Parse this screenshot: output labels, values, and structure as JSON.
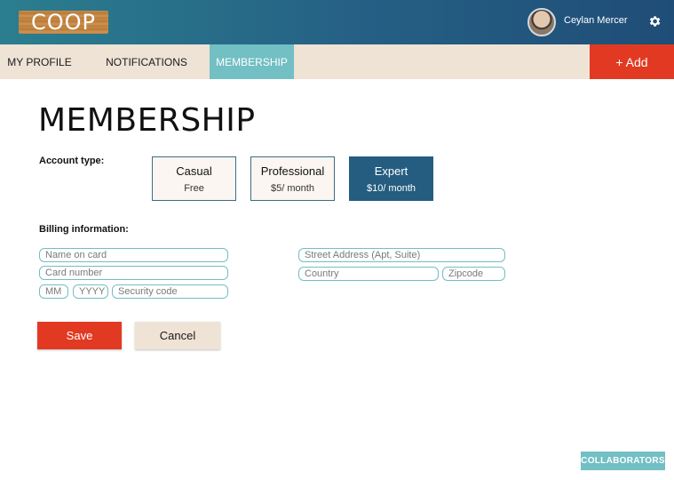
{
  "header": {
    "logo_text": "COOP",
    "user_name": "Ceylan Mercer",
    "settings_icon": "gear-icon",
    "avatar_icon": "user-avatar"
  },
  "nav": {
    "tabs": [
      {
        "label": "MY PROFILE"
      },
      {
        "label": "NOTIFICATIONS"
      },
      {
        "label": "MEMBERSHIP",
        "active": true
      }
    ],
    "add_label": "+ Add"
  },
  "main": {
    "title": "MEMBERSHIP",
    "account_type_label": "Account type:",
    "plans": [
      {
        "name": "Casual",
        "price": "Free"
      },
      {
        "name": "Professional",
        "price": "$5/ month"
      },
      {
        "name": "Expert",
        "price": "$10/ month",
        "selected": true
      }
    ],
    "billing_label": "Billing information:",
    "fields": {
      "name_on_card": {
        "placeholder": "Name on card",
        "value": ""
      },
      "card_number": {
        "placeholder": "Card number",
        "value": ""
      },
      "mm": {
        "placeholder": "MM",
        "value": ""
      },
      "yyyy": {
        "placeholder": "YYYY",
        "value": ""
      },
      "security_code": {
        "placeholder": "Security code",
        "value": ""
      },
      "street_address": {
        "placeholder": "Street Address (Apt, Suite)",
        "value": ""
      },
      "country": {
        "placeholder": "Country",
        "value": ""
      },
      "zipcode": {
        "placeholder": "Zipcode",
        "value": ""
      }
    },
    "save_label": "Save",
    "cancel_label": "Cancel"
  },
  "footer": {
    "collaborators_label": "COLLABORATORS"
  },
  "colors": {
    "header_gradient_start": "#2b7e8f",
    "header_gradient_end": "#1f4d77",
    "nav_background": "#efe3d6",
    "active_tab": "#72bfc4",
    "accent_red": "#e23a22",
    "selected_plan": "#255d80",
    "field_border": "#72bfc4"
  }
}
